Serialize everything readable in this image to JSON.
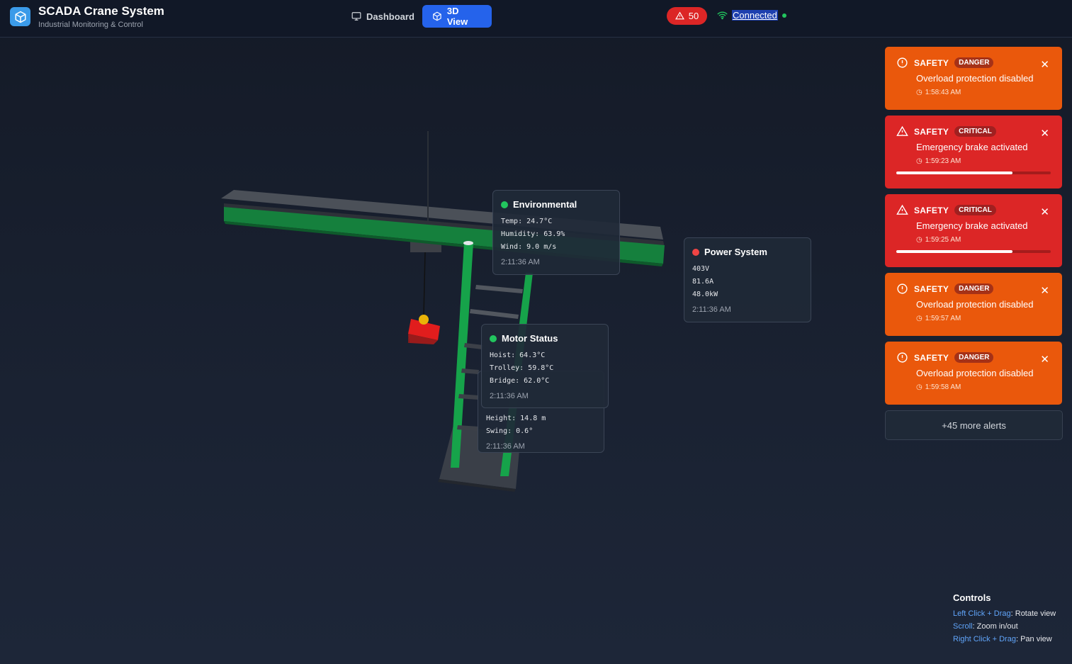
{
  "app": {
    "title": "SCADA Crane System",
    "subtitle": "Industrial Monitoring & Control",
    "logo_icon": "cube-icon",
    "accent": "#2563eb"
  },
  "nav": {
    "dashboard_label": "Dashboard",
    "view3d_label": "3D View",
    "active": "3D View"
  },
  "status": {
    "alert_count": "50",
    "connection": "Connected"
  },
  "cards": {
    "environmental": {
      "title": "Environmental",
      "status_color": "#22c55e",
      "lines": [
        "Temp: 24.7°C",
        "Humidity: 63.9%",
        "Wind: 9.0 m/s"
      ],
      "time": "2:11:36 AM"
    },
    "power": {
      "title": "Power System",
      "status_color": "#ef4444",
      "lines": [
        "403V",
        "81.6A",
        "48.0kW"
      ],
      "time": "2:11:36 AM"
    },
    "motor": {
      "title": "Motor Status",
      "status_color": "#22c55e",
      "lines": [
        "Hoist: 64.3°C",
        "Trolley: 59.8°C",
        "Bridge: 62.0°C"
      ],
      "time": "2:11:36 AM"
    },
    "load": {
      "lines": [
        "Height: 14.8 m",
        "Swing: 0.6°"
      ],
      "time": "2:11:36 AM"
    }
  },
  "alerts": [
    {
      "category": "SAFETY",
      "severity": "DANGER",
      "message": "Overload protection disabled",
      "time": "1:58:43 AM",
      "color": "#ea580c"
    },
    {
      "category": "SAFETY",
      "severity": "CRITICAL",
      "message": "Emergency brake activated",
      "time": "1:59:23 AM",
      "color": "#dc2626",
      "progress": 0.75
    },
    {
      "category": "SAFETY",
      "severity": "CRITICAL",
      "message": "Emergency brake activated",
      "time": "1:59:25 AM",
      "color": "#dc2626",
      "progress": 0.75
    },
    {
      "category": "SAFETY",
      "severity": "DANGER",
      "message": "Overload protection disabled",
      "time": "1:59:57 AM",
      "color": "#ea580c"
    },
    {
      "category": "SAFETY",
      "severity": "DANGER",
      "message": "Overload protection disabled",
      "time": "1:59:58 AM",
      "color": "#ea580c"
    }
  ],
  "more_alerts": "+45 more alerts",
  "controls": {
    "title": "Controls",
    "rows": [
      {
        "key": "Left Click + Drag",
        "action": "Rotate view"
      },
      {
        "key": "Scroll",
        "action": "Zoom in/out"
      },
      {
        "key": "Right Click + Drag",
        "action": "Pan view"
      }
    ]
  }
}
